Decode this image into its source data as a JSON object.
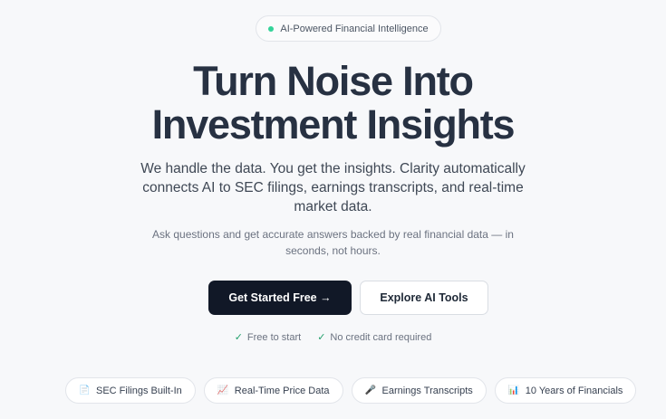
{
  "hero": {
    "badge": {
      "icon": "status-dot",
      "label": "AI-Powered Financial Intelligence",
      "dot_color": "#34d399"
    },
    "headline": [
      "Turn Noise Into",
      "Investment Insights"
    ],
    "subtitle": "We handle the data. You get the insights. Clarity automatically connects AI to SEC filings, earnings transcripts, and real-time market data.",
    "description": "Ask questions and get accurate answers backed by real financial data — in seconds, not hours."
  },
  "cta": {
    "primary_label": "Get Started Free →",
    "secondary_label": "Explore AI Tools",
    "primary_color": "#111827"
  },
  "assurances": [
    {
      "icon": "checkmark-icon",
      "glyph": "✓",
      "label": "Free to start"
    },
    {
      "icon": "checkmark-icon",
      "glyph": "✓",
      "label": "No credit card required"
    }
  ],
  "features": [
    {
      "icon": "document-icon",
      "glyph": "📄",
      "label": "SEC Filings Built-In"
    },
    {
      "icon": "trend-chart-icon",
      "glyph": "📈",
      "label": "Real-Time Price Data"
    },
    {
      "icon": "microphone-icon",
      "glyph": "🎤",
      "label": "Earnings Transcripts"
    },
    {
      "icon": "bar-chart-icon",
      "glyph": "📊",
      "label": "10 Years of Financials"
    }
  ]
}
